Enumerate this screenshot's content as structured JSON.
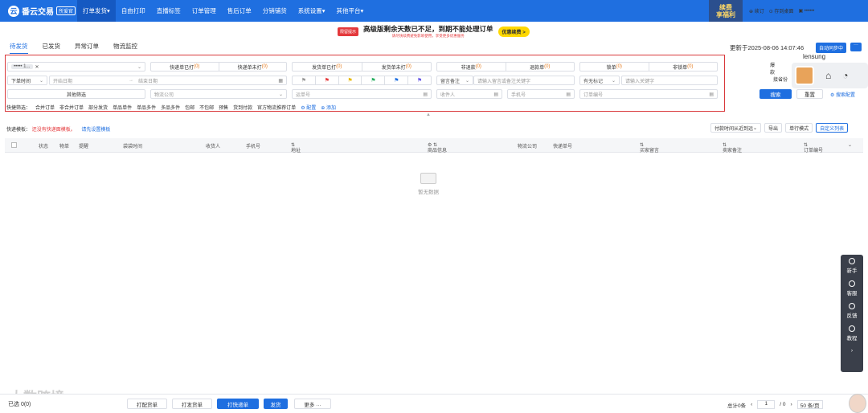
{
  "nav": {
    "logo_name": "番云交易",
    "logo_sub": "所爱官",
    "items": [
      "打单发货",
      "自由打印",
      "直播标签",
      "订单管理",
      "售后订单",
      "分销铺货",
      "系统设置",
      "其他平台"
    ],
    "promo_line1": "续费",
    "promo_line2": "享福利",
    "right": [
      "续订",
      "存到桌面",
      "••••••"
    ]
  },
  "banner": {
    "badge": "限留提示",
    "main": "高级版剩余天数已不足，到期不能处理订单",
    "sub": "请尽快续费避免影响使用，享受更多优惠服务",
    "button": "优惠续费 >"
  },
  "tabs": [
    "待发货",
    "已发货",
    "异常订单",
    "物流监控"
  ],
  "status": {
    "updated": "更新于2025-08-06 14:07:46",
    "autosync": "自动同步中"
  },
  "filters": {
    "shop_chip": "••••• 1...",
    "order_time": "下单时间",
    "start_date": "开始日期",
    "end_date": "结束日期",
    "other_filter": "其他筛选",
    "logistics": "物流公司",
    "express_printed": "快递单已打",
    "express_unprinted": "快递单未打",
    "ship_printed": "发货单已打",
    "ship_unprinted": "发货单未打",
    "non_refund": "非退款",
    "refund": "退款单",
    "lock": "锁单",
    "unlock": "非锁单",
    "count": "(0)",
    "seller_remark": "留言备注",
    "seller_remark_ph": "请输入留言或备注关键字",
    "flag_label": "有无标记",
    "flag_ph": "请输入关键字",
    "waybill": "运单号",
    "receiver": "收件人",
    "phone": "手机号",
    "order_no": "订单编号",
    "right1": "爆款",
    "right2": "接省份",
    "search": "搜索",
    "reset": "重置",
    "search_config": "搜索配置"
  },
  "quick": {
    "label": "快捷筛选：",
    "items": [
      "合并订单",
      "非合并订单",
      "部分发货",
      "单品单件",
      "单品多件",
      "多品多件",
      "包邮",
      "不包邮",
      "预售",
      "货到付款",
      "官方物流推荐订单"
    ],
    "config": "配置",
    "add": "添加"
  },
  "user": {
    "name": "lensung"
  },
  "template": {
    "label": "快递模板：",
    "warn": "还没有快递面模板。",
    "link": "请先设置模板"
  },
  "tools": [
    "付款时间从近到远",
    "导出",
    "单行模式",
    "自定义列表"
  ],
  "columns": [
    "状态",
    "物单",
    "提醒",
    "袋袋时间",
    "收货人",
    "手机号",
    "地址",
    "商品信息",
    "物流公司",
    "快递单号",
    "买家留言",
    "卖家备注",
    "订单编号"
  ],
  "empty": "暂无数据",
  "side": [
    "新手",
    "客服",
    "反馈",
    "教程"
  ],
  "bottom": {
    "selected": "已选 0(0)",
    "pick_list": "打配货单",
    "ship_list": "打发货单",
    "print_express": "打快递单",
    "ship": "发货",
    "more": "更多 ···",
    "total": "总计0条",
    "page": "1",
    "pages": "/ 0",
    "size": "50 条/页"
  },
  "watermark": "大数跨境"
}
